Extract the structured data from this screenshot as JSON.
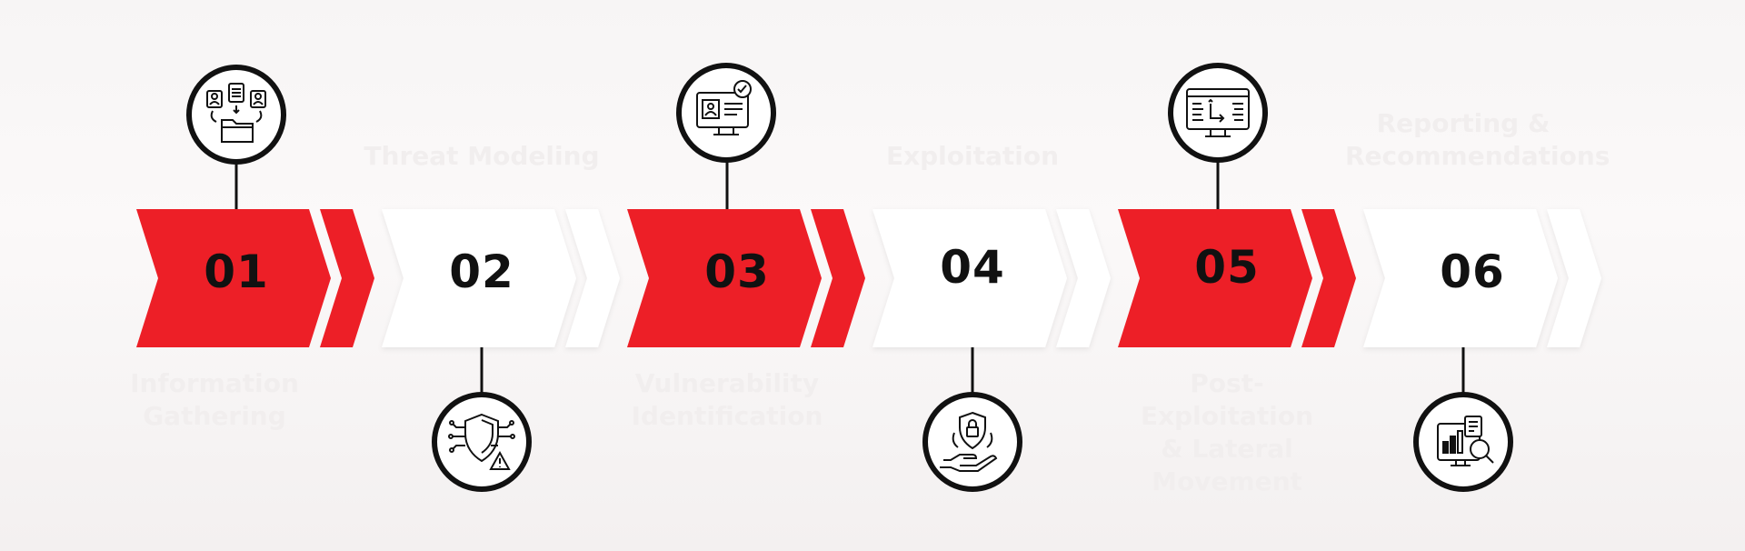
{
  "colors": {
    "accent": "#ed1f27",
    "white": "#ffffff",
    "ink": "#111111",
    "ghost_text": "#f1eeee"
  },
  "steps": [
    {
      "number": "01",
      "label": "Information\nGathering",
      "icon": "document-folder-icon",
      "style": "red"
    },
    {
      "number": "02",
      "label": "Threat Modeling",
      "icon": "shield-warning-network-icon",
      "style": "white"
    },
    {
      "number": "03",
      "label": "Vulnerability\nIdentification",
      "icon": "monitor-id-check-icon",
      "style": "red"
    },
    {
      "number": "04",
      "label": "Exploitation",
      "icon": "hand-shield-lock-icon",
      "style": "white"
    },
    {
      "number": "05",
      "label": "Post-Exploitation\n& Lateral\nMovement",
      "icon": "monitor-code-icon",
      "style": "red"
    },
    {
      "number": "06",
      "label": "Reporting &\nRecommendations",
      "icon": "report-magnifier-icon",
      "style": "white"
    }
  ]
}
